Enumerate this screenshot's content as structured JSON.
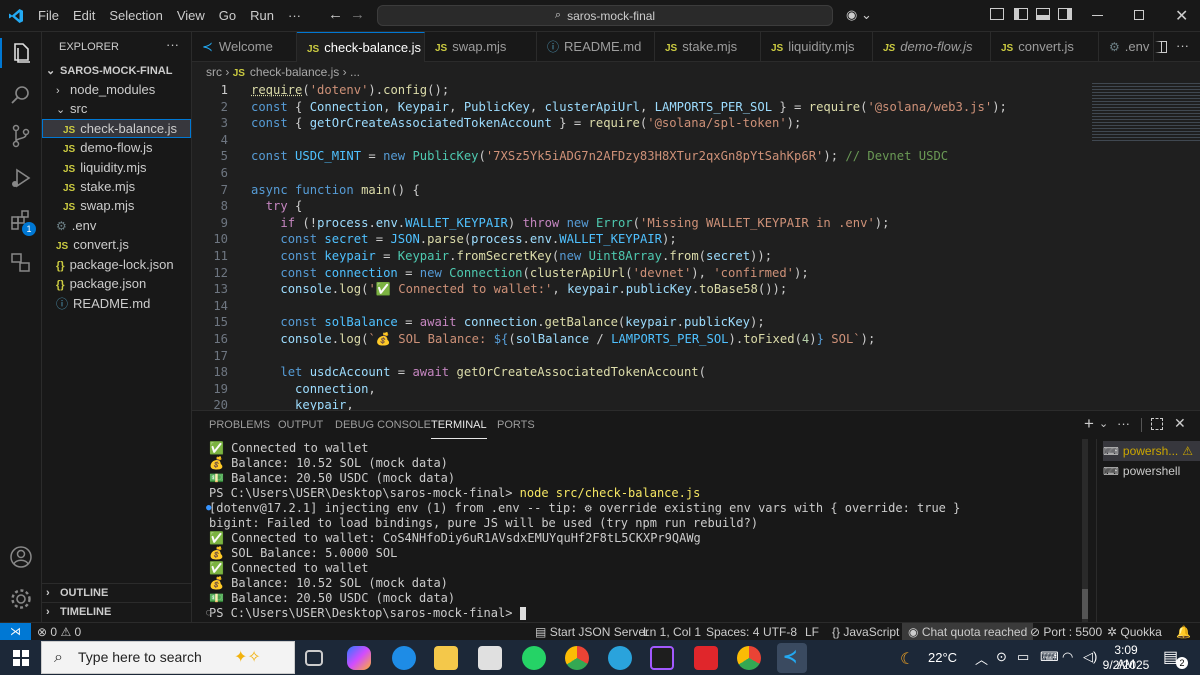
{
  "title_bar": {
    "menus": [
      "File",
      "Edit",
      "Selection",
      "View",
      "Go",
      "Run",
      "···"
    ],
    "search_text": "saros-mock-final"
  },
  "sidebar": {
    "header": "EXPLORER",
    "project": "SAROS-MOCK-FINAL",
    "items": [
      {
        "label": "node_modules"
      },
      {
        "label": "src"
      },
      {
        "label": "check-balance.js"
      },
      {
        "label": "demo-flow.js"
      },
      {
        "label": "liquidity.mjs"
      },
      {
        "label": "stake.mjs"
      },
      {
        "label": "swap.mjs"
      },
      {
        "label": ".env"
      },
      {
        "label": "convert.js"
      },
      {
        "label": "package-lock.json"
      },
      {
        "label": "package.json"
      },
      {
        "label": "README.md"
      }
    ],
    "outline": "OUTLINE",
    "timeline": "TIMELINE",
    "extensions_badge": "1"
  },
  "tabs": [
    {
      "label": "Welcome"
    },
    {
      "label": "check-balance.js"
    },
    {
      "label": "swap.mjs"
    },
    {
      "label": "README.md"
    },
    {
      "label": "stake.mjs"
    },
    {
      "label": "liquidity.mjs"
    },
    {
      "label": "demo-flow.js"
    },
    {
      "label": "convert.js"
    },
    {
      "label": ".env"
    }
  ],
  "breadcrumb": {
    "folder": "src",
    "file": "check-balance.js",
    "rest": "..."
  },
  "editor": {
    "line_numbers": [
      "1",
      "2",
      "3",
      "4",
      "5",
      "6",
      "7",
      "8",
      "9",
      "10",
      "11",
      "12",
      "13",
      "14",
      "15",
      "16",
      "17",
      "18",
      "19",
      "20"
    ]
  },
  "panel": {
    "tabs": [
      "PROBLEMS",
      "OUTPUT",
      "DEBUG CONSOLE",
      "TERMINAL",
      "PORTS"
    ],
    "terminal_lines": [
      "✅ Connected to wallet",
      "💰 Balance: 10.52 SOL (mock data)",
      "💵 Balance: 20.50 USDC (mock data)",
      "PS C:\\Users\\USER\\Desktop\\saros-mock-final> ",
      "[dotenv@17.2.1] injecting env (1) from .env -- tip: ⚙ override existing env vars with { override: true }",
      "bigint: Failed to load bindings, pure JS will be used (try npm run rebuild?)",
      "✅ Connected to wallet: CoS4NHfoDiy6uR1AVsdxEMUYquHf2F8tL5CKXPr9QAWg",
      "💰 SOL Balance: 5.0000 SOL",
      "✅ Connected to wallet",
      "💰 Balance: 10.52 SOL (mock data)",
      "💵 Balance: 20.50 USDC (mock data)",
      "PS C:\\Users\\USER\\Desktop\\saros-mock-final> "
    ],
    "command": "node src/check-balance.js",
    "terminals": [
      "powersh...",
      "powershell"
    ]
  },
  "status_bar": {
    "errors": "0",
    "warnings": "0",
    "json_server": "Start JSON Server",
    "position": "Ln 1, Col 1",
    "spaces": "Spaces: 4",
    "encoding": "UTF-8",
    "eol": "LF",
    "language": "JavaScript",
    "chat": "Chat quota reached",
    "port": "Port : 5500",
    "quokka": "Quokka"
  },
  "taskbar": {
    "search_placeholder": "Type here to search",
    "temperature": "22°C",
    "time": "3:09 AM",
    "date": "9/2/2025",
    "notifications": "2"
  }
}
